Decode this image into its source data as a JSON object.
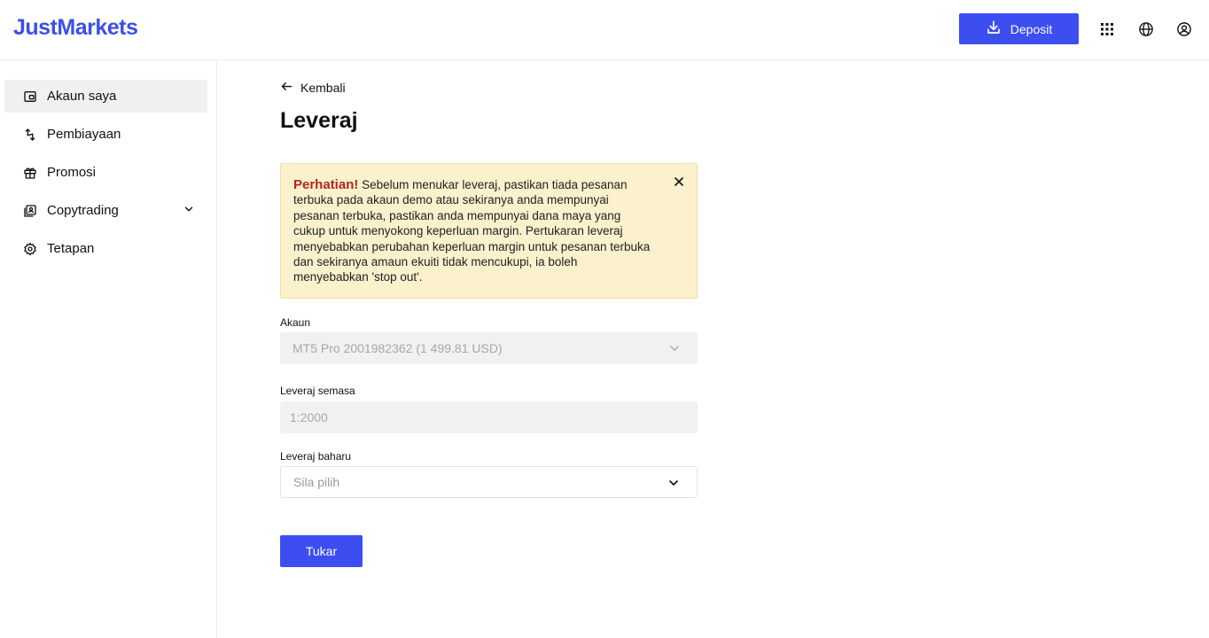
{
  "header": {
    "logo": "JustMarkets",
    "deposit_label": "Deposit",
    "icons": [
      "download-icon",
      "apps-grid-icon",
      "globe-icon",
      "user-circle-icon"
    ]
  },
  "sidebar": {
    "items": [
      {
        "label": "Akaun saya",
        "icon": "wallet-icon",
        "active": true
      },
      {
        "label": "Pembiayaan",
        "icon": "transfer-arrows-icon",
        "active": false
      },
      {
        "label": "Promosi",
        "icon": "gift-icon",
        "active": false
      },
      {
        "label": "Copytrading",
        "icon": "copytrading-icon",
        "active": false
      },
      {
        "label": "Tetapan",
        "icon": "gear-icon",
        "active": false
      }
    ]
  },
  "main": {
    "back_label": "Kembali",
    "title": "Leveraj",
    "alert": {
      "heading": "Perhatian!",
      "text": "Sebelum menukar leveraj, pastikan tiada pesanan terbuka pada akaun demo atau sekiranya anda mempunyai pesanan terbuka, pastikan anda mempunyai dana maya yang cukup untuk menyokong keperluan margin. Pertukaran leveraj menyebabkan perubahan keperluan margin untuk pesanan terbuka dan sekiranya amaun ekuiti tidak mencukupi, ia boleh menyebabkan 'stop out'."
    },
    "account": {
      "label": "Akaun",
      "value": "MT5 Pro 2001982362 (1 499.81 USD)"
    },
    "current_leverage": {
      "label": "Leveraj semasa",
      "value": "1:2000"
    },
    "new_leverage": {
      "label": "Leveraj baharu",
      "placeholder": "Sila pilih"
    },
    "submit_label": "Tukar"
  },
  "colors": {
    "brand": "#3d4ef0",
    "alert_bg": "#fbf1cc",
    "warning_text": "#b3261e"
  }
}
